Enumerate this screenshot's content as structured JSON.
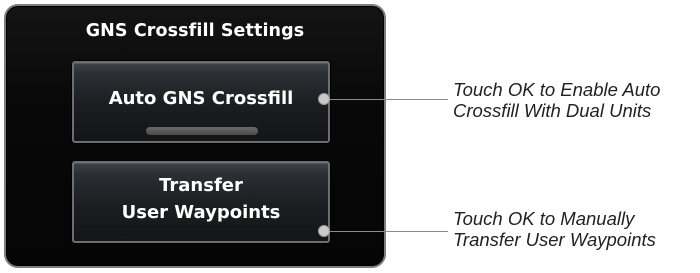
{
  "panel": {
    "title": "GNS Crossfill Settings",
    "auto_crossfill_button": {
      "label": "Auto GNS Crossfill"
    },
    "transfer_waypoints_button": {
      "line1": "Transfer",
      "line2": "User Waypoints"
    }
  },
  "callouts": {
    "auto_crossfill": {
      "line1": "Touch OK to Enable Auto",
      "line2": "Crossfill With Dual Units"
    },
    "transfer_waypoints": {
      "line1": "Touch OK to Manually",
      "line2": "Transfer User Waypoints"
    }
  },
  "colors": {
    "panel_background": "#080808",
    "button_border": "#6b6e72",
    "button_text": "#ffffff",
    "callout_text": "#222222",
    "callout_line": "#8c8c8c"
  }
}
